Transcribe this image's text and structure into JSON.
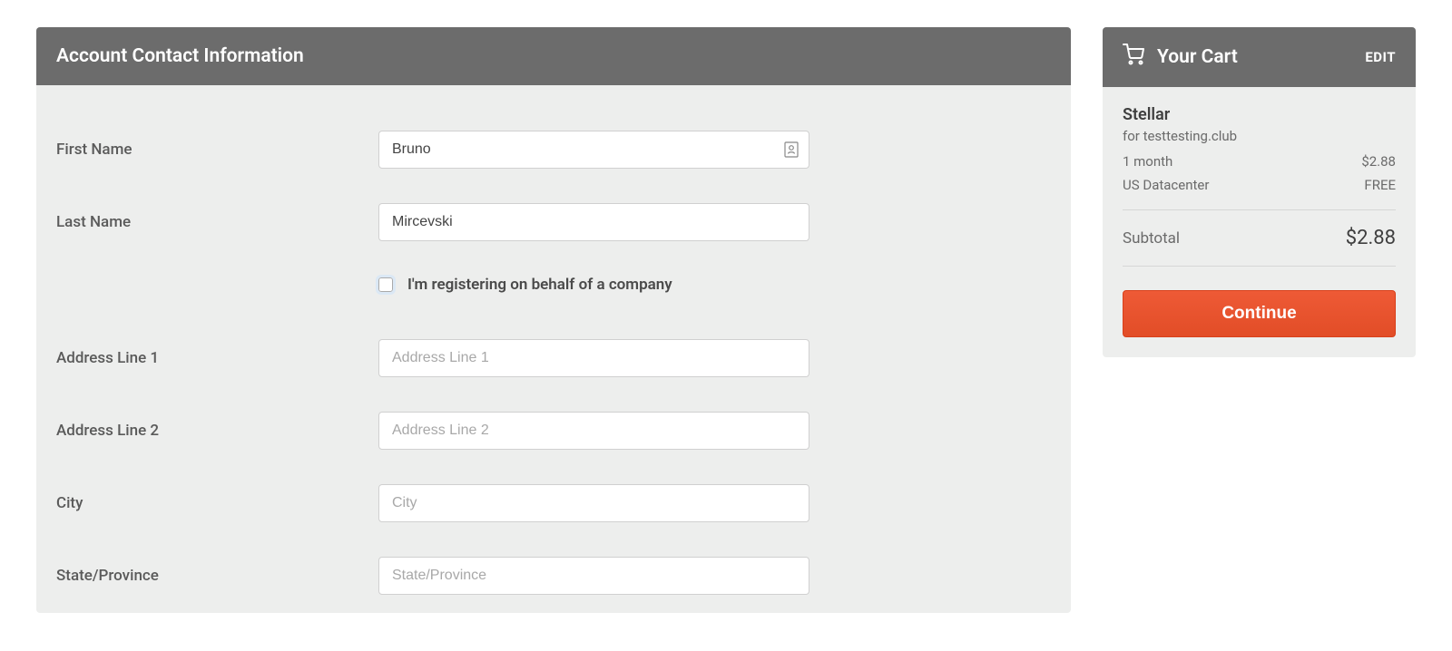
{
  "form": {
    "title": "Account Contact Information",
    "fields": {
      "first_name": {
        "label": "First Name",
        "value": "Bruno",
        "placeholder": ""
      },
      "last_name": {
        "label": "Last Name",
        "value": "Mircevski",
        "placeholder": ""
      },
      "company_check": {
        "label": "I'm registering on behalf of a company",
        "checked": false
      },
      "address1": {
        "label": "Address Line 1",
        "value": "",
        "placeholder": "Address Line 1"
      },
      "address2": {
        "label": "Address Line 2",
        "value": "",
        "placeholder": "Address Line 2"
      },
      "city": {
        "label": "City",
        "value": "",
        "placeholder": "City"
      },
      "state": {
        "label": "State/Province",
        "value": "",
        "placeholder": "State/Province"
      }
    }
  },
  "cart": {
    "title": "Your Cart",
    "edit_label": "EDIT",
    "product": "Stellar",
    "for_text": "for testtesting.club",
    "lines": [
      {
        "label": "1 month",
        "value": "$2.88"
      },
      {
        "label": "US Datacenter",
        "value": "FREE"
      }
    ],
    "subtotal_label": "Subtotal",
    "subtotal_value": "$2.88",
    "continue_label": "Continue"
  }
}
